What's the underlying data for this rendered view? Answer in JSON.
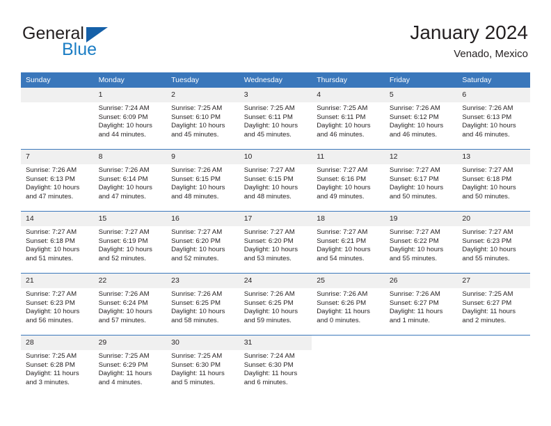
{
  "brand": {
    "word1": "General",
    "word2": "Blue",
    "triangle_color": "#1560a8",
    "blue_color": "#1b7dc4"
  },
  "header": {
    "title": "January 2024",
    "subtitle": "Venado, Mexico"
  },
  "theme": {
    "header_bg": "#3a77bb",
    "daynum_bg": "#f0f0f0",
    "text": "#231f20"
  },
  "weekdays": [
    "Sunday",
    "Monday",
    "Tuesday",
    "Wednesday",
    "Thursday",
    "Friday",
    "Saturday"
  ],
  "weeks": [
    [
      {
        "day": "",
        "lines": []
      },
      {
        "day": "1",
        "lines": [
          "Sunrise: 7:24 AM",
          "Sunset: 6:09 PM",
          "Daylight: 10 hours",
          "and 44 minutes."
        ]
      },
      {
        "day": "2",
        "lines": [
          "Sunrise: 7:25 AM",
          "Sunset: 6:10 PM",
          "Daylight: 10 hours",
          "and 45 minutes."
        ]
      },
      {
        "day": "3",
        "lines": [
          "Sunrise: 7:25 AM",
          "Sunset: 6:11 PM",
          "Daylight: 10 hours",
          "and 45 minutes."
        ]
      },
      {
        "day": "4",
        "lines": [
          "Sunrise: 7:25 AM",
          "Sunset: 6:11 PM",
          "Daylight: 10 hours",
          "and 46 minutes."
        ]
      },
      {
        "day": "5",
        "lines": [
          "Sunrise: 7:26 AM",
          "Sunset: 6:12 PM",
          "Daylight: 10 hours",
          "and 46 minutes."
        ]
      },
      {
        "day": "6",
        "lines": [
          "Sunrise: 7:26 AM",
          "Sunset: 6:13 PM",
          "Daylight: 10 hours",
          "and 46 minutes."
        ]
      }
    ],
    [
      {
        "day": "7",
        "lines": [
          "Sunrise: 7:26 AM",
          "Sunset: 6:13 PM",
          "Daylight: 10 hours",
          "and 47 minutes."
        ]
      },
      {
        "day": "8",
        "lines": [
          "Sunrise: 7:26 AM",
          "Sunset: 6:14 PM",
          "Daylight: 10 hours",
          "and 47 minutes."
        ]
      },
      {
        "day": "9",
        "lines": [
          "Sunrise: 7:26 AM",
          "Sunset: 6:15 PM",
          "Daylight: 10 hours",
          "and 48 minutes."
        ]
      },
      {
        "day": "10",
        "lines": [
          "Sunrise: 7:27 AM",
          "Sunset: 6:15 PM",
          "Daylight: 10 hours",
          "and 48 minutes."
        ]
      },
      {
        "day": "11",
        "lines": [
          "Sunrise: 7:27 AM",
          "Sunset: 6:16 PM",
          "Daylight: 10 hours",
          "and 49 minutes."
        ]
      },
      {
        "day": "12",
        "lines": [
          "Sunrise: 7:27 AM",
          "Sunset: 6:17 PM",
          "Daylight: 10 hours",
          "and 50 minutes."
        ]
      },
      {
        "day": "13",
        "lines": [
          "Sunrise: 7:27 AM",
          "Sunset: 6:18 PM",
          "Daylight: 10 hours",
          "and 50 minutes."
        ]
      }
    ],
    [
      {
        "day": "14",
        "lines": [
          "Sunrise: 7:27 AM",
          "Sunset: 6:18 PM",
          "Daylight: 10 hours",
          "and 51 minutes."
        ]
      },
      {
        "day": "15",
        "lines": [
          "Sunrise: 7:27 AM",
          "Sunset: 6:19 PM",
          "Daylight: 10 hours",
          "and 52 minutes."
        ]
      },
      {
        "day": "16",
        "lines": [
          "Sunrise: 7:27 AM",
          "Sunset: 6:20 PM",
          "Daylight: 10 hours",
          "and 52 minutes."
        ]
      },
      {
        "day": "17",
        "lines": [
          "Sunrise: 7:27 AM",
          "Sunset: 6:20 PM",
          "Daylight: 10 hours",
          "and 53 minutes."
        ]
      },
      {
        "day": "18",
        "lines": [
          "Sunrise: 7:27 AM",
          "Sunset: 6:21 PM",
          "Daylight: 10 hours",
          "and 54 minutes."
        ]
      },
      {
        "day": "19",
        "lines": [
          "Sunrise: 7:27 AM",
          "Sunset: 6:22 PM",
          "Daylight: 10 hours",
          "and 55 minutes."
        ]
      },
      {
        "day": "20",
        "lines": [
          "Sunrise: 7:27 AM",
          "Sunset: 6:23 PM",
          "Daylight: 10 hours",
          "and 55 minutes."
        ]
      }
    ],
    [
      {
        "day": "21",
        "lines": [
          "Sunrise: 7:27 AM",
          "Sunset: 6:23 PM",
          "Daylight: 10 hours",
          "and 56 minutes."
        ]
      },
      {
        "day": "22",
        "lines": [
          "Sunrise: 7:26 AM",
          "Sunset: 6:24 PM",
          "Daylight: 10 hours",
          "and 57 minutes."
        ]
      },
      {
        "day": "23",
        "lines": [
          "Sunrise: 7:26 AM",
          "Sunset: 6:25 PM",
          "Daylight: 10 hours",
          "and 58 minutes."
        ]
      },
      {
        "day": "24",
        "lines": [
          "Sunrise: 7:26 AM",
          "Sunset: 6:25 PM",
          "Daylight: 10 hours",
          "and 59 minutes."
        ]
      },
      {
        "day": "25",
        "lines": [
          "Sunrise: 7:26 AM",
          "Sunset: 6:26 PM",
          "Daylight: 11 hours",
          "and 0 minutes."
        ]
      },
      {
        "day": "26",
        "lines": [
          "Sunrise: 7:26 AM",
          "Sunset: 6:27 PM",
          "Daylight: 11 hours",
          "and 1 minute."
        ]
      },
      {
        "day": "27",
        "lines": [
          "Sunrise: 7:25 AM",
          "Sunset: 6:27 PM",
          "Daylight: 11 hours",
          "and 2 minutes."
        ]
      }
    ],
    [
      {
        "day": "28",
        "lines": [
          "Sunrise: 7:25 AM",
          "Sunset: 6:28 PM",
          "Daylight: 11 hours",
          "and 3 minutes."
        ]
      },
      {
        "day": "29",
        "lines": [
          "Sunrise: 7:25 AM",
          "Sunset: 6:29 PM",
          "Daylight: 11 hours",
          "and 4 minutes."
        ]
      },
      {
        "day": "30",
        "lines": [
          "Sunrise: 7:25 AM",
          "Sunset: 6:30 PM",
          "Daylight: 11 hours",
          "and 5 minutes."
        ]
      },
      {
        "day": "31",
        "lines": [
          "Sunrise: 7:24 AM",
          "Sunset: 6:30 PM",
          "Daylight: 11 hours",
          "and 6 minutes."
        ]
      },
      {
        "day": "",
        "lines": []
      },
      {
        "day": "",
        "lines": []
      },
      {
        "day": "",
        "lines": []
      }
    ]
  ]
}
